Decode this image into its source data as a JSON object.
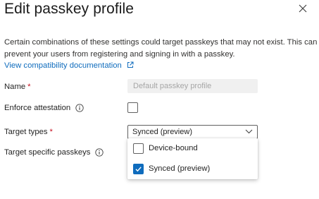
{
  "panel": {
    "title": "Edit passkey profile",
    "description_line1": "Certain combinations of these settings could target passkeys that may not exist. This can",
    "description_line2": "prevent your users from registering and signing in with a passkey.",
    "doc_link": "View compatibility documentation"
  },
  "form": {
    "name_label": "Name",
    "name_required_mark": "*",
    "name_placeholder": "Default passkey profile",
    "enforce_label": "Enforce attestation",
    "enforce_checked": false,
    "target_types_label": "Target types",
    "target_types_required_mark": "*",
    "target_types_value": "Synced (preview)",
    "target_specific_label": "Target specific passkeys"
  },
  "dropdown": {
    "options": [
      {
        "label": "Device-bound",
        "checked": false
      },
      {
        "label": "Synced (preview)",
        "checked": true
      }
    ]
  },
  "colors": {
    "accent": "#0f6cbd",
    "required": "#c50f1f"
  },
  "icons": {
    "close": "close-icon",
    "external_link": "external-link-icon",
    "info": "info-icon",
    "chevron": "chevron-down-icon",
    "checkmark": "checkmark-icon"
  }
}
